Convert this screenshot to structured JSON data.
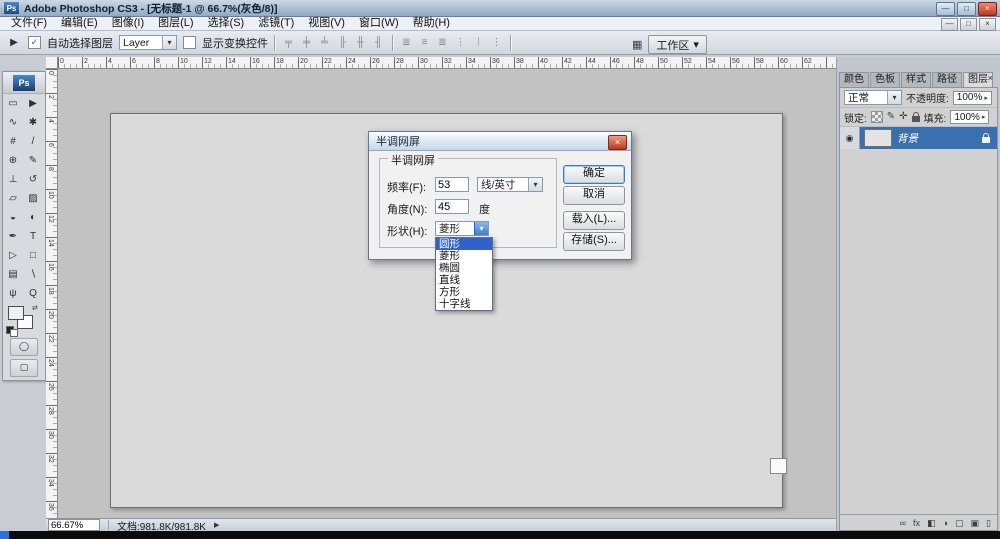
{
  "glyphs": {
    "check": "✓",
    "down_arrow": "▾",
    "popup_arrow": "▸",
    "eye": "◉",
    "swap": "⇄",
    "workspace": "▦",
    "tool": "▶"
  },
  "titlebar": {
    "app_initials": "Ps",
    "title": "Adobe Photoshop CS3 - [无标题-1 @ 66.7%(灰色/8)]",
    "minimize": "—",
    "maximize": "□",
    "close": "×"
  },
  "menubar": {
    "items": [
      {
        "name": "menu-file",
        "label": "文件(F)"
      },
      {
        "name": "menu-edit",
        "label": "编辑(E)"
      },
      {
        "name": "menu-image",
        "label": "图像(I)"
      },
      {
        "name": "menu-layer",
        "label": "图层(L)"
      },
      {
        "name": "menu-select",
        "label": "选择(S)"
      },
      {
        "name": "menu-filter",
        "label": "滤镜(T)"
      },
      {
        "name": "menu-view",
        "label": "视图(V)"
      },
      {
        "name": "menu-window",
        "label": "窗口(W)"
      },
      {
        "name": "menu-help",
        "label": "帮助(H)"
      }
    ],
    "doc_minimize": "—",
    "doc_restore": "□",
    "doc_close": "×"
  },
  "optionsbar": {
    "auto_select_label": "自动选择图层",
    "layer_dropdown_value": "Layer",
    "show_transform_label": "显示变换控件",
    "align_icons": [
      {
        "name": "align-top-edges-icon",
        "glyph": "╤"
      },
      {
        "name": "align-vertical-centers-icon",
        "glyph": "╪"
      },
      {
        "name": "align-bottom-edges-icon",
        "glyph": "╧"
      },
      {
        "name": "align-left-edges-icon",
        "glyph": "╟"
      },
      {
        "name": "align-horizontal-centers-icon",
        "glyph": "╫"
      },
      {
        "name": "align-right-edges-icon",
        "glyph": "╢"
      }
    ],
    "distribute_icons": [
      {
        "name": "distribute-top-edges-icon",
        "glyph": "≣"
      },
      {
        "name": "distribute-vertical-centers-icon",
        "glyph": "≡"
      },
      {
        "name": "distribute-bottom-edges-icon",
        "glyph": "≣"
      },
      {
        "name": "distribute-left-edges-icon",
        "glyph": "⋮"
      },
      {
        "name": "distribute-horizontal-centers-icon",
        "glyph": "⁞"
      },
      {
        "name": "distribute-right-edges-icon",
        "glyph": "⋮"
      }
    ],
    "workspace_label": "工作区"
  },
  "toolbox": {
    "logo": "Ps",
    "tools": [
      {
        "name": "rectangular-marquee-tool",
        "glyph": "▭"
      },
      {
        "name": "move-tool",
        "glyph": "▶"
      },
      {
        "name": "lasso-tool",
        "glyph": "∿"
      },
      {
        "name": "quick-selection-tool",
        "glyph": "✱"
      },
      {
        "name": "crop-tool",
        "glyph": "#"
      },
      {
        "name": "slice-tool",
        "glyph": "/"
      },
      {
        "name": "healing-brush-tool",
        "glyph": "⊕"
      },
      {
        "name": "brush-tool",
        "glyph": "✎"
      },
      {
        "name": "clone-stamp-tool",
        "glyph": "⊥"
      },
      {
        "name": "history-brush-tool",
        "glyph": "↺"
      },
      {
        "name": "eraser-tool",
        "glyph": "▱"
      },
      {
        "name": "gradient-tool",
        "glyph": "▨"
      },
      {
        "name": "blur-tool",
        "glyph": "◒"
      },
      {
        "name": "dodge-tool",
        "glyph": "◐"
      },
      {
        "name": "pen-tool",
        "glyph": "✒"
      },
      {
        "name": "type-tool",
        "glyph": "T"
      },
      {
        "name": "path-selection-tool",
        "glyph": "▷"
      },
      {
        "name": "shape-tool",
        "glyph": "□"
      },
      {
        "name": "notes-tool",
        "glyph": "▤"
      },
      {
        "name": "eyedropper-tool",
        "glyph": "∖"
      },
      {
        "name": "hand-tool",
        "glyph": "ψ"
      },
      {
        "name": "zoom-tool",
        "glyph": "Q"
      }
    ]
  },
  "dialog": {
    "title": "半调网屏",
    "group_title": "半调网屏",
    "frequency_label": "频率(F):",
    "frequency_value": "53",
    "frequency_unit": "线/英寸",
    "angle_label": "角度(N):",
    "angle_value": "45",
    "angle_unit": "度",
    "shape_label": "形状(H):",
    "shape_value": "菱形",
    "shape_options": [
      {
        "name": "shape-option-round",
        "label": "圆形",
        "selected": true
      },
      {
        "name": "shape-option-diamond",
        "label": "菱形"
      },
      {
        "name": "shape-option-ellipse",
        "label": "椭圆"
      },
      {
        "name": "shape-option-line",
        "label": "直线"
      },
      {
        "name": "shape-option-square",
        "label": "方形"
      },
      {
        "name": "shape-option-cross",
        "label": "十字线"
      }
    ],
    "ok": "确定",
    "cancel": "取消",
    "load": "载入(L)...",
    "save": "存储(S)...",
    "close_glyph": "×"
  },
  "panels": {
    "tabs": [
      {
        "name": "tab-color",
        "label": "颜色"
      },
      {
        "name": "tab-swatches",
        "label": "色板"
      },
      {
        "name": "tab-styles",
        "label": "样式"
      },
      {
        "name": "tab-paths",
        "label": "路径"
      },
      {
        "name": "tab-layers",
        "label": "图层",
        "selected": true
      }
    ],
    "close_glyph": "×",
    "blend_mode": "正常",
    "opacity_label": "不透明度:",
    "opacity_value": "100%",
    "lock_label": "锁定:",
    "fill_label": "填充:",
    "fill_value": "100%",
    "layer_name": "背景",
    "bottom_icons": [
      {
        "name": "link-layers-icon",
        "glyph": "∞"
      },
      {
        "name": "layer-style-icon",
        "glyph": "fx"
      },
      {
        "name": "layer-mask-icon",
        "glyph": "◧"
      },
      {
        "name": "adjustment-layer-icon",
        "glyph": "◑"
      },
      {
        "name": "new-group-icon",
        "glyph": "▢"
      },
      {
        "name": "new-layer-icon",
        "glyph": "▣"
      },
      {
        "name": "delete-layer-icon",
        "glyph": "▯"
      }
    ]
  },
  "statusbar": {
    "zoom": "66.67%",
    "doc_info": "文档:981.8K/981.8K",
    "arrow": "▶"
  },
  "rulers": {
    "h_count": 32,
    "h_step": 2,
    "h_spacing": 24,
    "v_count": 19,
    "v_step": 2,
    "v_spacing": 24
  }
}
